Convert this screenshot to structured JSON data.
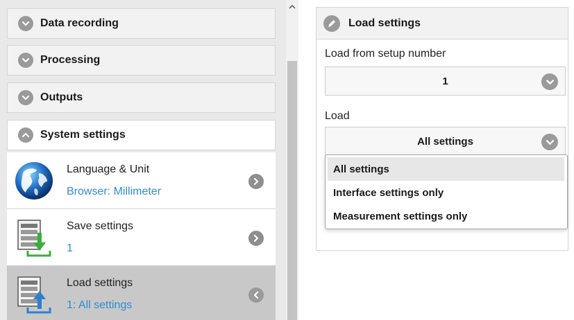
{
  "sidebar": {
    "sections": [
      {
        "label": "Data recording"
      },
      {
        "label": "Processing"
      },
      {
        "label": "Outputs"
      },
      {
        "label": "System settings"
      }
    ],
    "items": [
      {
        "title": "Language & Unit",
        "value": "Browser: Millimeter"
      },
      {
        "title": "Save settings",
        "value": "1"
      },
      {
        "title": "Load settings",
        "value": "1: All settings"
      }
    ]
  },
  "panel": {
    "title": "Load settings",
    "setup_label": "Load from setup number",
    "setup_value": "1",
    "load_label": "Load",
    "load_value": "All settings"
  },
  "menu": {
    "options": [
      {
        "label": "All settings"
      },
      {
        "label": "Interface settings only"
      },
      {
        "label": "Measurement settings only"
      }
    ],
    "selected_index": 0
  },
  "colors": {
    "link_blue": "#2f8dd0",
    "icon_gray": "#9a9a9a",
    "active_row": "#c8c8c8",
    "save_arrow": "#3cae3c",
    "load_arrow": "#2f7fd0"
  },
  "icons": {
    "section_closed": "chevron-down-circle",
    "section_open": "chevron-up-circle",
    "item_go": "chevron-right-circle",
    "item_back": "chevron-left-circle",
    "panel": "pencil-circle",
    "dropdown": "chevron-down-circle"
  }
}
